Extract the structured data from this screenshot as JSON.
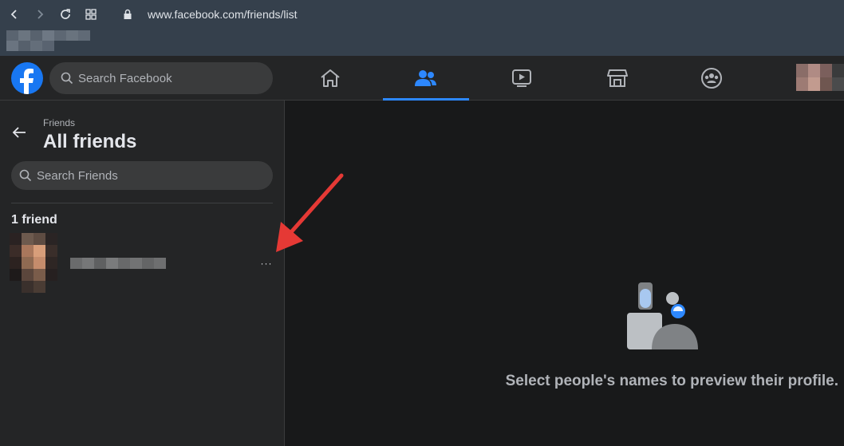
{
  "browser": {
    "url": "www.facebook.com/friends/list"
  },
  "header": {
    "search_placeholder": "Search Facebook",
    "tabs": [
      "home",
      "friends",
      "watch",
      "marketplace",
      "groups"
    ],
    "active_tab": "friends",
    "accent_color": "#2d88ff",
    "brand_color": "#1877f2"
  },
  "sidebar": {
    "breadcrumb": "Friends",
    "title": "All friends",
    "search_placeholder": "Search Friends",
    "count_label": "1 friend",
    "more_label": "···"
  },
  "main": {
    "empty_message": "Select people's names to preview their profile."
  },
  "annotation": {
    "arrow_color": "#e53935"
  }
}
